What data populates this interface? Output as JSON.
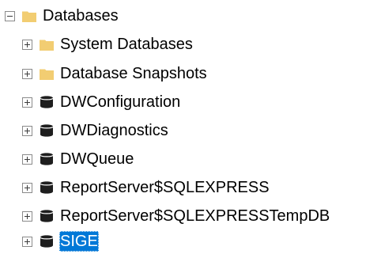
{
  "tree": {
    "root": {
      "label": "Databases",
      "icon": "folder-icon",
      "expanded": true
    },
    "children": [
      {
        "label": "System Databases",
        "icon": "folder-icon",
        "expanded": false,
        "selected": false
      },
      {
        "label": "Database Snapshots",
        "icon": "folder-icon",
        "expanded": false,
        "selected": false
      },
      {
        "label": "DWConfiguration",
        "icon": "database-icon",
        "expanded": false,
        "selected": false
      },
      {
        "label": "DWDiagnostics",
        "icon": "database-icon",
        "expanded": false,
        "selected": false
      },
      {
        "label": "DWQueue",
        "icon": "database-icon",
        "expanded": false,
        "selected": false
      },
      {
        "label": "ReportServer$SQLEXPRESS",
        "icon": "database-icon",
        "expanded": false,
        "selected": false
      },
      {
        "label": "ReportServer$SQLEXPRESSTempDB",
        "icon": "database-icon",
        "expanded": false,
        "selected": false
      },
      {
        "label": "SIGE",
        "icon": "database-icon",
        "expanded": false,
        "selected": true
      }
    ]
  },
  "colors": {
    "folder": "#f2cd72",
    "database": "#1e1e1e",
    "selection": "#0078d7",
    "expander_border": "#8a8a8a"
  }
}
